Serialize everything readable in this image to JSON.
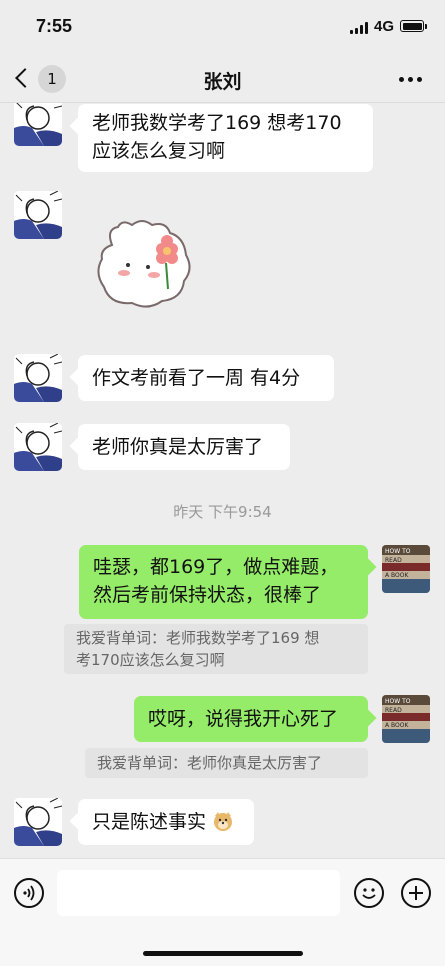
{
  "status_bar": {
    "time": "7:55",
    "network": "4G"
  },
  "nav": {
    "unread_count": "1",
    "title": "张刘"
  },
  "messages": {
    "m1_line1": "老师我数学考了169  想考170",
    "m1_line2": "应该怎么复习啊",
    "m3": "作文考前看了一周 有4分",
    "m4": "老师你真是太厉害了",
    "timestamp": "昨天 下午9:54",
    "m5_line1": "哇瑟，都169了，做点难题，",
    "m5_line2": "然后考前保持状态，很棒了",
    "q1_line1": "我爱背单词：老师我数学考了169  想",
    "q1_line2": "考170应该怎么复习啊",
    "m6": "哎呀，说得我开心死了",
    "q2": "我爱背单词：老师你真是太厉害了",
    "m7": "只是陈述事实"
  },
  "book_cover": {
    "line1": "HOW TO",
    "line2": "READ",
    "line3": "A BOOK"
  },
  "input": {
    "placeholder": ""
  },
  "icons": {
    "back": "chevron-left-icon",
    "more": "more-dots-icon",
    "voice": "voice-icon",
    "emoji": "emoji-icon",
    "add": "plus-icon",
    "sticker_emoji": "doge-emoji"
  },
  "colors": {
    "background": "#ededed",
    "sent_bubble": "#95ec69",
    "received_bubble": "#ffffff"
  }
}
